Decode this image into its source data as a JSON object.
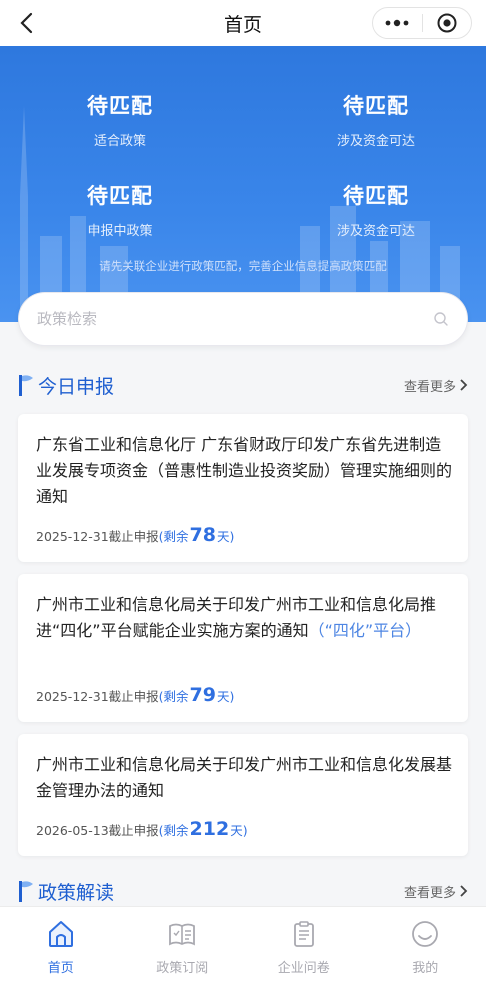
{
  "nav": {
    "title": "首页",
    "back_icon": "chevron-left-icon",
    "more_icon": "more-dots-icon",
    "close_icon": "target-circle-icon"
  },
  "hero": {
    "stats": [
      {
        "value": "待匹配",
        "label": "适合政策"
      },
      {
        "value": "待匹配",
        "label": "涉及资金可达"
      },
      {
        "value": "待匹配",
        "label": "申报中政策"
      },
      {
        "value": "待匹配",
        "label": "涉及资金可达"
      }
    ],
    "hint": "请先关联企业进行政策匹配，完善企业信息提高政策匹配"
  },
  "search": {
    "placeholder": "政策检索",
    "icon": "search-icon"
  },
  "today": {
    "title": "今日申报",
    "more": "查看更多",
    "items": [
      {
        "title": "广东省工业和信息化厅 广东省财政厅印发广东省先进制造业发展专项资金（普惠性制造业投资奖励）管理实施细则的通知",
        "tag": "",
        "deadline": "2025-12-31截止申报",
        "remain_prefix": "(剩余",
        "days": "78",
        "remain_suffix": "天)"
      },
      {
        "title": "广州市工业和信息化局关于印发广州市工业和信息化局推进“四化”平台赋能企业实施方案的通知",
        "tag": "（“四化”平台）",
        "deadline": "2025-12-31截止申报",
        "remain_prefix": "(剩余",
        "days": "79",
        "remain_suffix": "天)"
      },
      {
        "title": "广州市工业和信息化局关于印发广州市工业和信息化发展基金管理办法的通知",
        "tag": "",
        "deadline": "2026-05-13截止申报",
        "remain_prefix": "(剩余",
        "days": "212",
        "remain_suffix": "天)"
      }
    ]
  },
  "interpret": {
    "title": "政策解读",
    "more": "查看更多"
  },
  "tabbar": {
    "items": [
      {
        "label": "首页",
        "icon": "home-icon",
        "active": true
      },
      {
        "label": "政策订阅",
        "icon": "book-icon",
        "active": false
      },
      {
        "label": "企业问卷",
        "icon": "clipboard-icon",
        "active": false
      },
      {
        "label": "我的",
        "icon": "smiley-icon",
        "active": false
      }
    ]
  },
  "colors": {
    "accent": "#2f6fe0",
    "hero_top": "#2e78de",
    "hero_bottom": "#4a93f0",
    "tab_inactive": "#a9a9b0"
  }
}
